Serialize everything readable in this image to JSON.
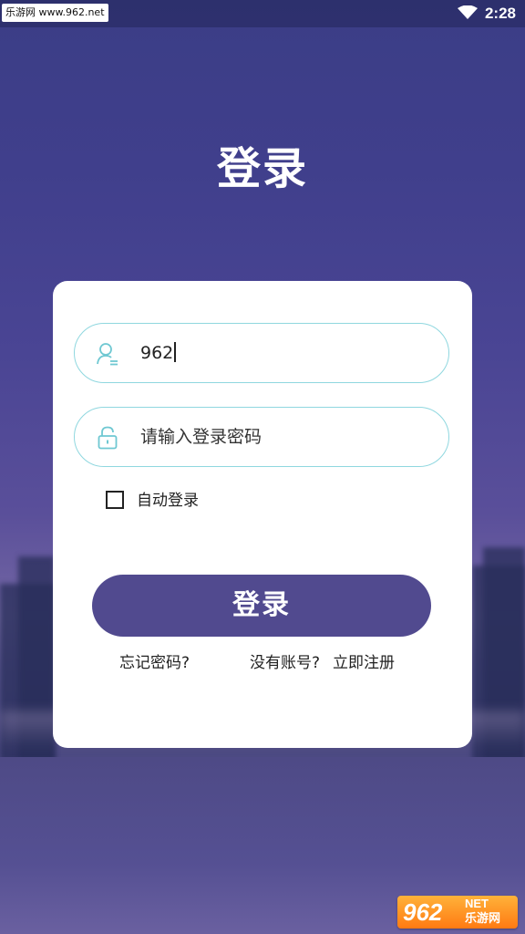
{
  "status_bar": {
    "watermark": "乐游网 www.962.net",
    "time": "2:28"
  },
  "page": {
    "title": "登录"
  },
  "form": {
    "username_value": "962",
    "password_placeholder": "请输入登录密码",
    "remember_label": "自动登录",
    "remember_checked": false,
    "login_button": "登录",
    "forgot_password": "忘记密码?",
    "no_account": "没有账号?",
    "register_now": "立即注册"
  },
  "watermark": {
    "number": "962",
    "net": "NET",
    "name": "乐游网"
  },
  "colors": {
    "background": "#403f8c",
    "accent_button": "#514a8f",
    "field_border": "#8fd7df",
    "icon": "#6fc8d2",
    "card": "#ffffff"
  },
  "icons": {
    "username": "user-icon",
    "password": "lock-icon",
    "status": "wifi-icon"
  }
}
